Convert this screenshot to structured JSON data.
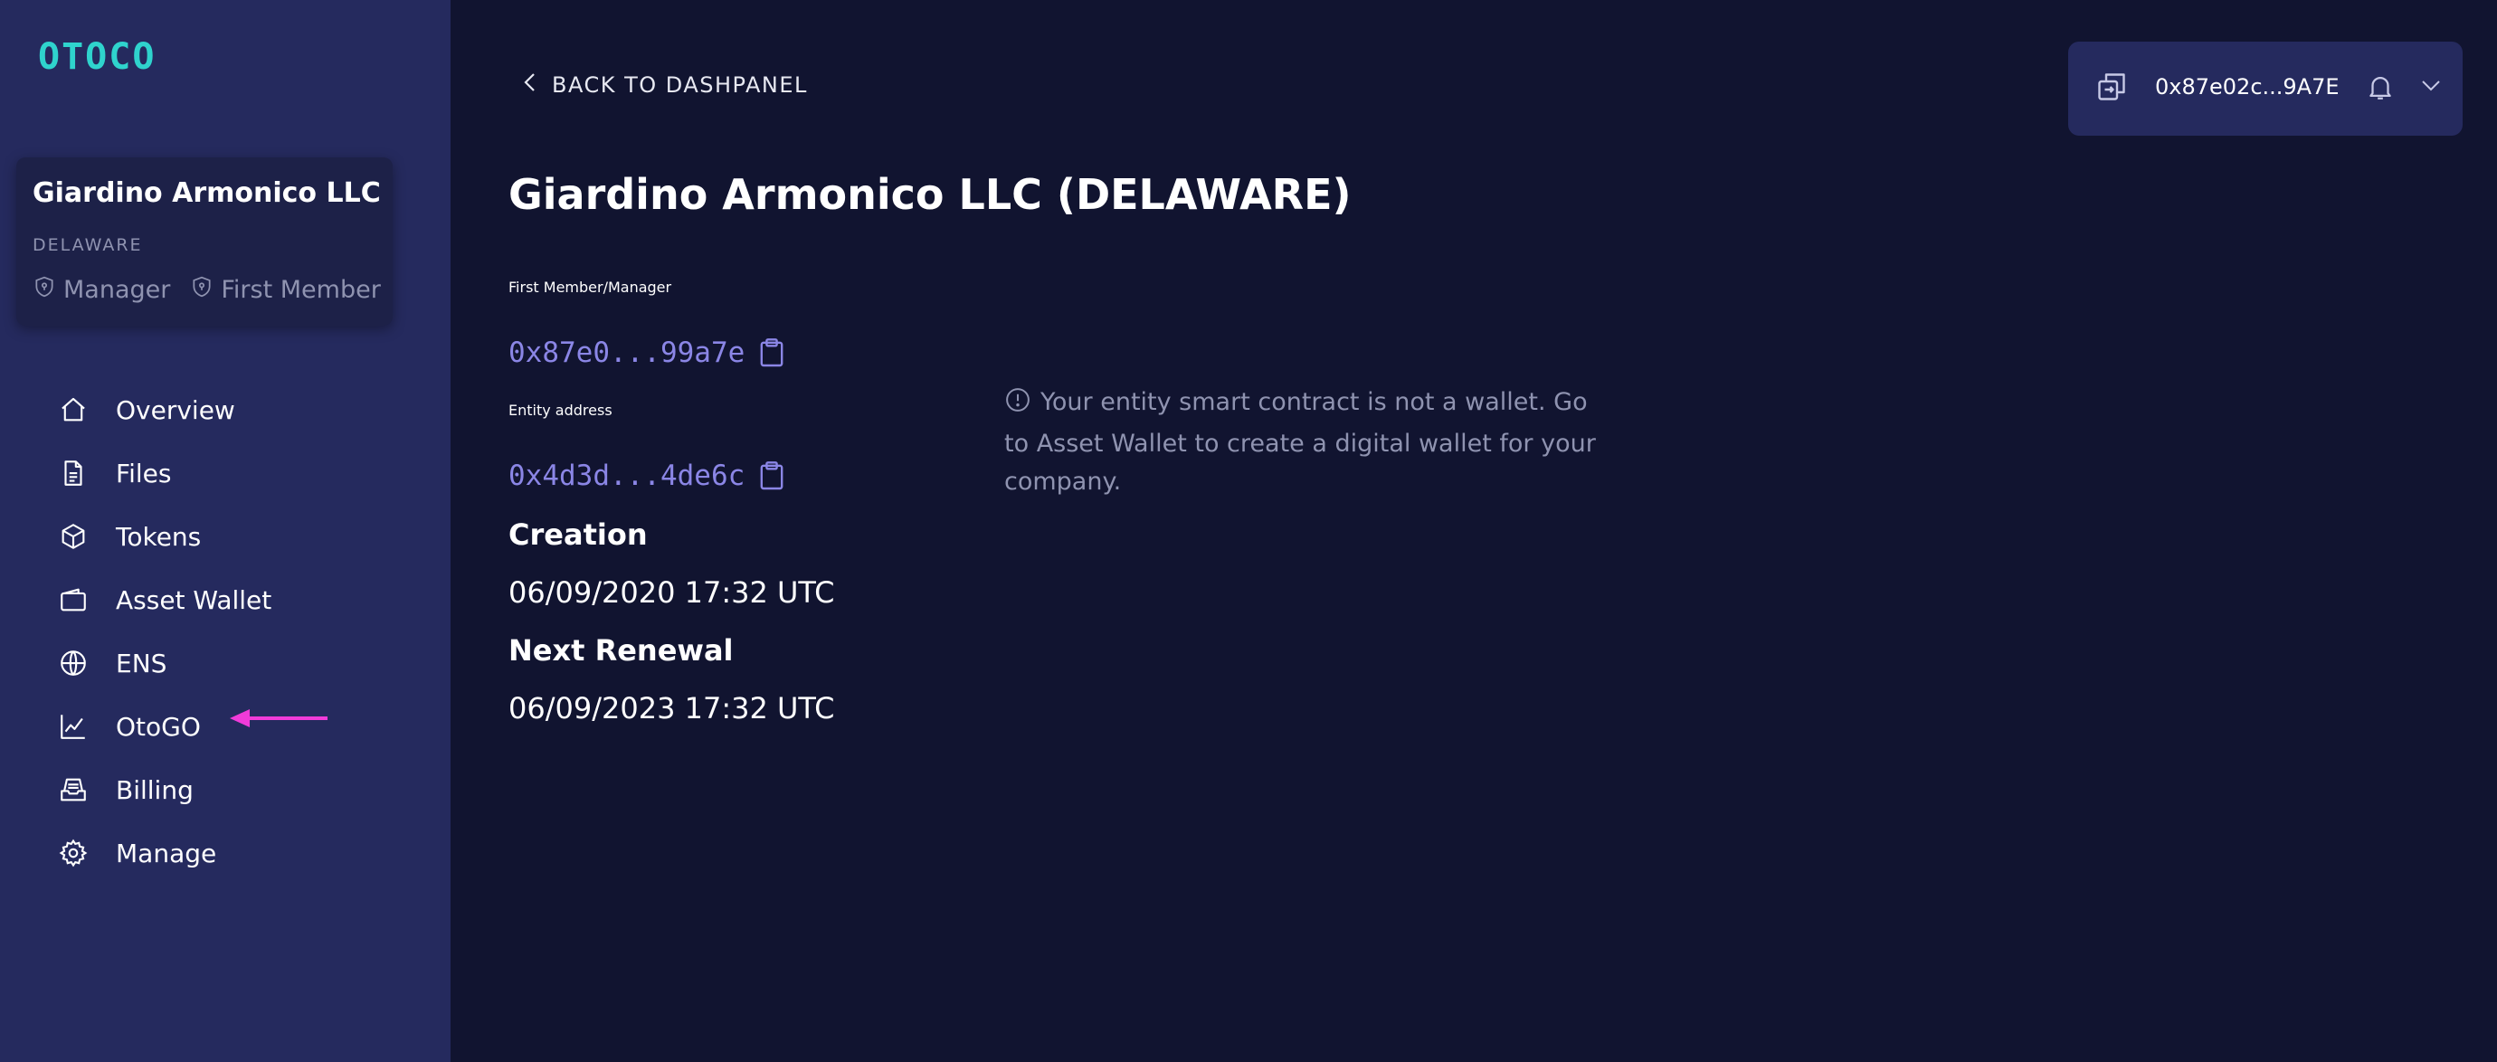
{
  "app": {
    "logo_text": "OTOCO",
    "colors": {
      "sidebar": "#252a5e",
      "background": "#111430",
      "accent": "#2fd3cd",
      "address": "#8b86e6",
      "arrow": "#f03bd9"
    }
  },
  "sidebar": {
    "entity": {
      "name": "Giardino Armonico LLC",
      "jurisdiction": "DELAWARE",
      "roles": [
        "Manager",
        "First Member"
      ]
    },
    "nav": [
      {
        "label": "Overview",
        "icon": "home-icon"
      },
      {
        "label": "Files",
        "icon": "file-icon"
      },
      {
        "label": "Tokens",
        "icon": "cube-icon"
      },
      {
        "label": "Asset Wallet",
        "icon": "wallet-icon"
      },
      {
        "label": "ENS",
        "icon": "globe-icon"
      },
      {
        "label": "OtoGO",
        "icon": "chart-line-icon"
      },
      {
        "label": "Billing",
        "icon": "inbox-icon"
      },
      {
        "label": "Manage",
        "icon": "gear-icon"
      }
    ]
  },
  "header": {
    "back_label": "BACK TO DASHPANEL",
    "wallet_address": "0x87e02c...9A7E"
  },
  "main": {
    "title": "Giardino Armonico LLC (DELAWARE)",
    "first_member_label": "First Member/Manager",
    "first_member_address": "0x87e0...99a7e",
    "entity_address_label": "Entity address",
    "entity_address": "0x4d3d...4de6c",
    "creation_label": "Creation",
    "creation_value": "06/09/2020 17:32 UTC",
    "renewal_label": "Next Renewal",
    "renewal_value": "06/09/2023 17:32 UTC",
    "notice": "Your entity smart contract is not a wallet. Go to Asset Wallet to create a digital wallet for your company."
  }
}
